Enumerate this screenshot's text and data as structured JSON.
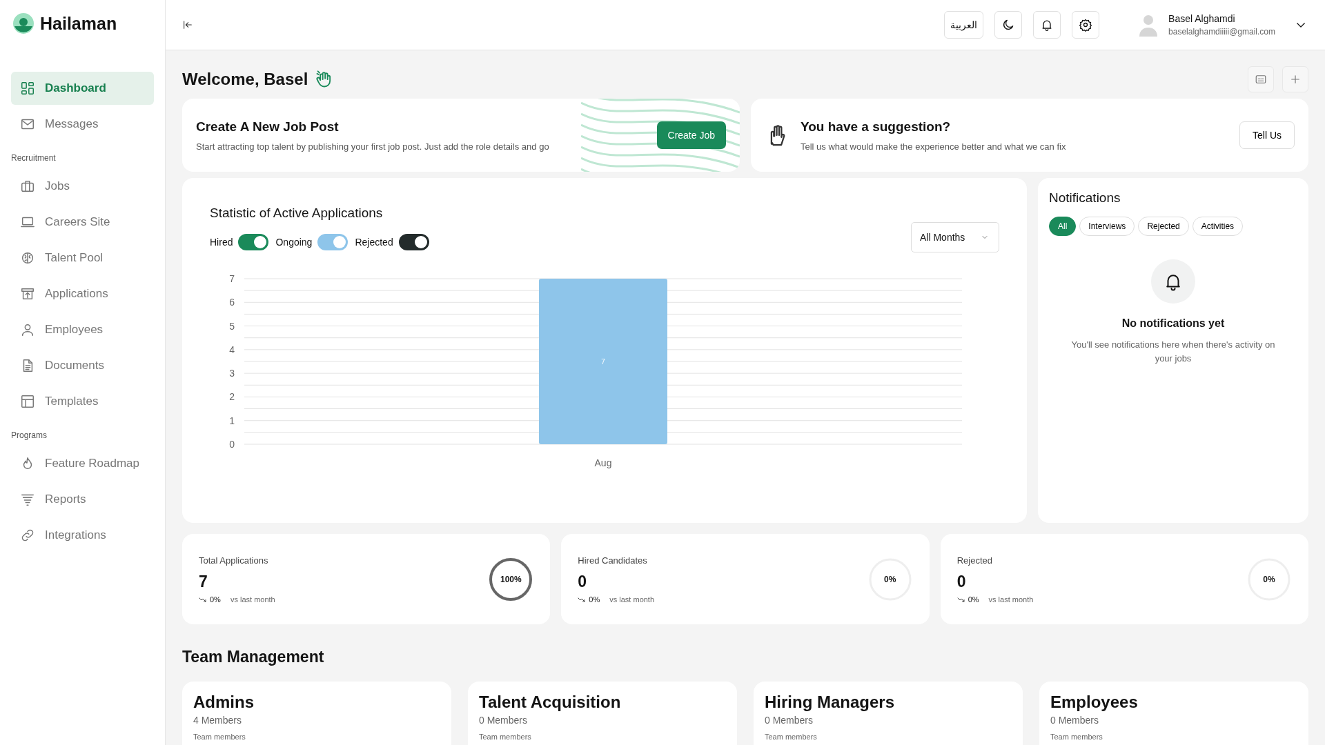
{
  "brand": {
    "name": "Hailaman"
  },
  "sidebar": {
    "sections": [
      {
        "items": [
          {
            "label": "Dashboard",
            "selected": true
          },
          {
            "label": "Messages",
            "selected": false
          }
        ]
      },
      {
        "title": "Recruitment",
        "items": [
          {
            "label": "Jobs",
            "selected": false
          },
          {
            "label": "Careers Site",
            "selected": false
          },
          {
            "label": "Talent Pool",
            "selected": false
          },
          {
            "label": "Applications",
            "selected": false
          },
          {
            "label": "Employees",
            "selected": false
          },
          {
            "label": "Documents",
            "selected": false
          },
          {
            "label": "Templates",
            "selected": false
          }
        ]
      },
      {
        "title": "Programs",
        "items": [
          {
            "label": "Feature Roadmap",
            "selected": false
          },
          {
            "label": "Reports",
            "selected": false
          },
          {
            "label": "Integrations",
            "selected": false
          }
        ]
      }
    ]
  },
  "topbar": {
    "language": "العربية",
    "user": {
      "name": "Basel Alghamdi",
      "email": "baselalghamdiiiii@gmail.com"
    }
  },
  "welcome": "Welcome, Basel",
  "promo_cards": [
    {
      "kind": "job",
      "title": "Create A New Job Post",
      "text": "Start attracting top talent by publishing your first job post. Just add the role details and go",
      "button": "Create Job"
    },
    {
      "kind": "suggestion",
      "title": "You have a suggestion?",
      "text": "Tell us what would make the experience better and what we can fix",
      "button": "Tell Us"
    }
  ],
  "statistics": {
    "title": "Statistic of Active Applications",
    "toggles": [
      {
        "label": "Hired",
        "on": true,
        "color": "#1a8a5a"
      },
      {
        "label": "Ongoing",
        "on": true,
        "color": "#8ec5ea"
      },
      {
        "label": "Rejected",
        "on": true,
        "color": "#232b2b"
      }
    ],
    "period": "All Months",
    "chart_data": {
      "type": "bar",
      "categories": [
        "Aug"
      ],
      "series": [
        {
          "color": "#8ec5ea",
          "values": [
            7
          ]
        }
      ],
      "grid": true,
      "ylim": [
        0,
        7
      ],
      "yticks": [
        0,
        1,
        2,
        3,
        4,
        5,
        6,
        7
      ],
      "data_labels": true
    }
  },
  "notifications": {
    "title": "Notifications",
    "filters": [
      {
        "label": "All",
        "selected": true
      },
      {
        "label": "Interviews",
        "selected": false
      },
      {
        "label": "Rejected",
        "selected": false
      },
      {
        "label": "Activities",
        "selected": false
      }
    ],
    "empty_title": "No notifications yet",
    "empty_text": "You'll see notifications here when there's activity on your jobs"
  },
  "stats": [
    {
      "label": "Total Applications",
      "value": "7",
      "change": "0%",
      "compare": "vs last month",
      "percent": "100%",
      "level": 1
    },
    {
      "label": "Hired Candidates",
      "value": "0",
      "change": "0%",
      "compare": "vs last month",
      "percent": "0%",
      "level": 0
    },
    {
      "label": "Rejected",
      "value": "0",
      "change": "0%",
      "compare": "vs last month",
      "percent": "0%",
      "level": 0
    }
  ],
  "team": {
    "title": "Team Management",
    "groups": [
      {
        "name": "Admins",
        "members": "4 Members",
        "caption": "Team members"
      },
      {
        "name": "Talent Acquisition",
        "members": "0 Members",
        "caption": "Team members"
      },
      {
        "name": "Hiring Managers",
        "members": "0 Members",
        "caption": "Team members"
      },
      {
        "name": "Employees",
        "members": "0 Members",
        "caption": "Team members"
      }
    ]
  }
}
